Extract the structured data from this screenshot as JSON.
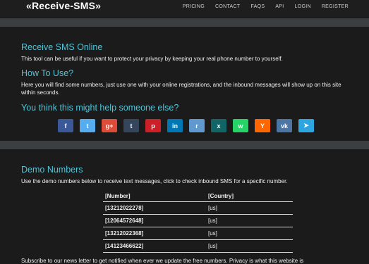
{
  "header": {
    "brand": "«Receive-SMS»",
    "nav": [
      "PRICING",
      "CONTACT",
      "FAQS",
      "API",
      "LOGIN",
      "REGISTER"
    ]
  },
  "intro": {
    "title": "Receive SMS Online",
    "text": "This tool can be useful if you want to protect your privacy by keeping your real phone number to yourself."
  },
  "howto": {
    "title": "How To Use?",
    "text": "Here you will find some numbers, just use one with your online registrations, and the inbound messages will show up on this site within seconds."
  },
  "share": {
    "title": "You think this might help someone else?",
    "buttons": [
      {
        "name": "facebook-icon",
        "glyph": "f",
        "color": "#3b5998"
      },
      {
        "name": "twitter-icon",
        "glyph": "t",
        "color": "#55acee"
      },
      {
        "name": "google-plus-icon",
        "glyph": "g+",
        "color": "#dd4b39"
      },
      {
        "name": "tumblr-icon",
        "glyph": "t",
        "color": "#35465c"
      },
      {
        "name": "pinterest-icon",
        "glyph": "p",
        "color": "#cb2027"
      },
      {
        "name": "linkedin-icon",
        "glyph": "in",
        "color": "#0077b5"
      },
      {
        "name": "reddit-icon",
        "glyph": "r",
        "color": "#5f99cf"
      },
      {
        "name": "xing-icon",
        "glyph": "x",
        "color": "#126567"
      },
      {
        "name": "whatsapp-icon",
        "glyph": "w",
        "color": "#25d366"
      },
      {
        "name": "ycombinator-icon",
        "glyph": "Y",
        "color": "#ff6600"
      },
      {
        "name": "vk-icon",
        "glyph": "vk",
        "color": "#4c75a3"
      },
      {
        "name": "telegram-icon",
        "glyph": "➤",
        "color": "#2ca5e0"
      }
    ]
  },
  "demo": {
    "title": "Demo Numbers",
    "text": "Use the demo numbers below to receive text messages, click to check inbound SMS for a specific number.",
    "columns": [
      "[Number]",
      "[Country]"
    ],
    "rows": [
      [
        "[13212022278]",
        "[us]"
      ],
      [
        "[12064572648]",
        "[us]"
      ],
      [
        "[13212022368]",
        "[us]"
      ],
      [
        "[14123466622]",
        "[us]"
      ]
    ]
  },
  "newsletter": {
    "text": "Subscribe to our news letter to get notified when ever we update the free numbers. Privacy is what this website is"
  }
}
